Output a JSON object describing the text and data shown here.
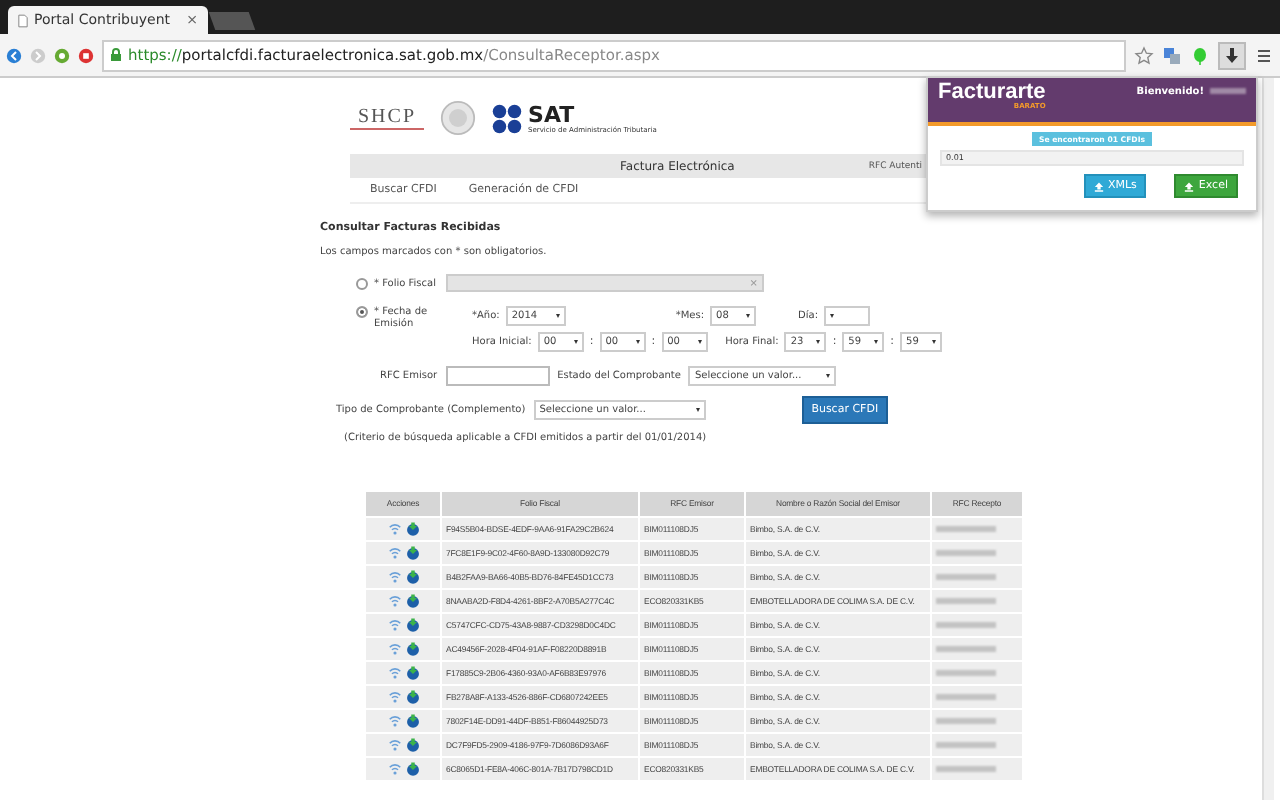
{
  "browser": {
    "tab_title": "Portal Contribuyent",
    "tab_close": "×",
    "url_scheme": "https://",
    "url_host": "portalcfdi.facturaelectronica.sat.gob.mx",
    "url_path": "/ConsultaReceptor.aspx"
  },
  "header": {
    "shcp": "SHCP",
    "sat": "SAT",
    "sat_subtitle": "Servicio de Administración Tributaria",
    "nav_title": "Factura Electrónica",
    "nav_right": "RFC Autenti"
  },
  "menu": [
    {
      "label": "Buscar CFDI"
    },
    {
      "label": "Generación de CFDI"
    }
  ],
  "form": {
    "title": "Consultar Facturas Recibidas",
    "note": "Los campos marcados con * son obligatorios.",
    "folio": {
      "label": "* Folio Fiscal",
      "selected": false,
      "clear": "×"
    },
    "fecha": {
      "label": "* Fecha de Emisión",
      "selected": true,
      "year_label": "*Año:",
      "year": "2014",
      "month_label": "*Mes:",
      "month": "08",
      "day_label": "Día:",
      "start_label": "Hora Inicial:",
      "start": [
        "00",
        "00",
        "00"
      ],
      "end_label": "Hora Final:",
      "end": [
        "23",
        "59",
        "59"
      ],
      "separator": ":"
    },
    "rfc_label": "RFC Emisor",
    "estado_label": "Estado del Comprobante",
    "estado_placeholder": "Seleccione un valor...",
    "tipo_label": "Tipo de Comprobante (Complemento)",
    "tipo_placeholder": "Seleccione un valor...",
    "search_button": "Buscar CFDI",
    "criteria": "(Criterio de búsqueda aplicable a CFDI emitidos a partir del 01/01/2014)"
  },
  "table": {
    "columns": [
      "Acciones",
      "Folio Fiscal",
      "RFC Emisor",
      "Nombre o Razón Social del Emisor",
      "RFC Recepto"
    ],
    "rows": [
      {
        "folio": "F94S5B04-BDSE-4EDF-9AA6-91FA29C2B624",
        "rfc": "BIM011108DJ5",
        "nombre": "Bimbo, S.A. de C.V."
      },
      {
        "folio": "7FC8E1F9-9C02-4F60-8A9D-133080D92C79",
        "rfc": "BIM011108DJ5",
        "nombre": "Bimbo, S.A. de C.V."
      },
      {
        "folio": "B4B2FAA9-BA66-40B5-BD76-84FE45D1CC73",
        "rfc": "BIM011108DJ5",
        "nombre": "Bimbo, S.A. de C.V."
      },
      {
        "folio": "8NAABA2D-F8D4-4261-8BF2-A70B5A277C4C",
        "rfc": "ECO820331KB5",
        "nombre": "EMBOTELLADORA DE COLIMA S.A. DE C.V."
      },
      {
        "folio": "C5747CFC-CD75-43A8-9887-CD3298D0C4DC",
        "rfc": "BIM011108DJ5",
        "nombre": "Bimbo, S.A. de C.V."
      },
      {
        "folio": "AC49456F-2028-4F04-91AF-F08220D8891B",
        "rfc": "BIM011108DJ5",
        "nombre": "Bimbo, S.A. de C.V."
      },
      {
        "folio": "F17885C9-2B06-4360-93A0-AF6B83E97976",
        "rfc": "BIM011108DJ5",
        "nombre": "Bimbo, S.A. de C.V."
      },
      {
        "folio": "FB278A8F-A133-4526-886F-CD6807242EE5",
        "rfc": "BIM011108DJ5",
        "nombre": "Bimbo, S.A. de C.V."
      },
      {
        "folio": "7802F14E-DD91-44DF-B851-F86044925D73",
        "rfc": "BIM011108DJ5",
        "nombre": "Bimbo, S.A. de C.V."
      },
      {
        "folio": "DC7F9FD5-2909-4186-97F9-7D6086D93A6F",
        "rfc": "BIM011108DJ5",
        "nombre": "Bimbo, S.A. de C.V."
      },
      {
        "folio": "6C8065D1-FE8A-406C-801A-7B17D798CD1D",
        "rfc": "ECO820331KB5",
        "nombre": "EMBOTELLADORA DE COLIMA S.A. DE C.V."
      }
    ]
  },
  "popup": {
    "logo": "Facturarte",
    "logo_sub": "BARATO",
    "welcome": "Bienvenido!",
    "badge": "Se encontraron 01 CFDIs",
    "amount": "0.01",
    "buttons": [
      {
        "label": "XMLs",
        "kind": "info"
      },
      {
        "label": "Excel",
        "kind": "success"
      }
    ]
  }
}
